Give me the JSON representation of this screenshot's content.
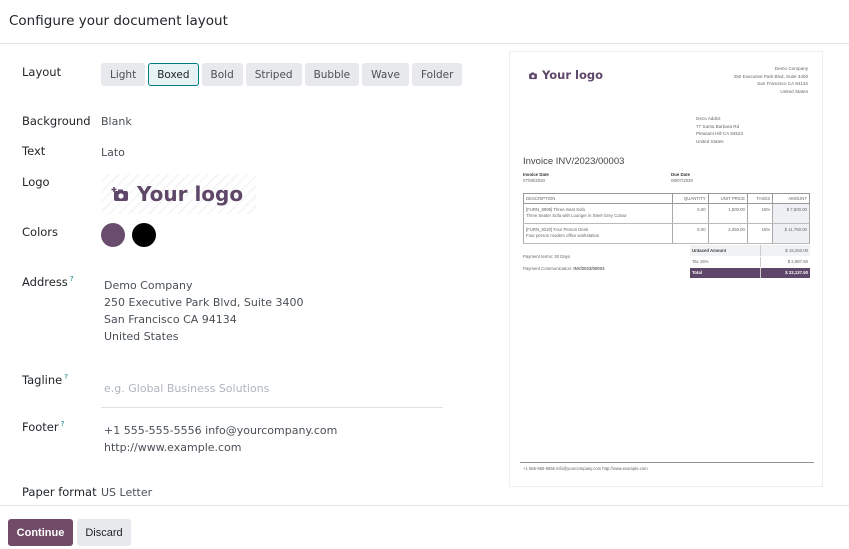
{
  "header": {
    "title": "Configure your document layout"
  },
  "form": {
    "layout": {
      "label": "Layout",
      "options": [
        "Light",
        "Boxed",
        "Bold",
        "Striped",
        "Bubble",
        "Wave",
        "Folder"
      ],
      "selected": "Boxed"
    },
    "background": {
      "label": "Background",
      "value": "Blank"
    },
    "text": {
      "label": "Text",
      "value": "Lato"
    },
    "logo": {
      "label": "Logo",
      "text": "Your logo"
    },
    "colors": {
      "label": "Colors",
      "primary": "#6a4c6e",
      "secondary": "#000000"
    },
    "address": {
      "label": "Address",
      "help": "?",
      "lines": [
        "Demo Company",
        "250 Executive Park Blvd, Suite 3400",
        "San Francisco CA 94134",
        "United States"
      ]
    },
    "tagline": {
      "label": "Tagline",
      "help": "?",
      "value": "",
      "placeholder": "e.g. Global Business Solutions"
    },
    "footer": {
      "label": "Footer",
      "help": "?",
      "lines": [
        "+1 555-555-5556 info@yourcompany.com",
        "http://www.example.com"
      ]
    },
    "paper_format": {
      "label": "Paper format",
      "value": "US Letter"
    }
  },
  "buttons": {
    "continue": "Continue",
    "discard": "Discard"
  },
  "preview": {
    "logo_text": "Your logo",
    "company_lines": [
      "Demo Company",
      "250 Executive Park Blvd, Suite 3400",
      "San Francisco CA 94134",
      "United States"
    ],
    "customer_lines": [
      "Deco Addict",
      "77 Santa Barbara Rd",
      "Pleasant Hill CA 94523",
      "United States"
    ],
    "title": "Invoice INV/2023/00003",
    "invoice_date_label": "Invoice Date",
    "invoice_date": "07/08/2020",
    "due_date_label": "Due Date",
    "due_date": "08/07/2020",
    "columns": [
      "DESCRIPTION",
      "QUANTITY",
      "UNIT PRICE",
      "TAXES",
      "AMOUNT"
    ],
    "rows": [
      {
        "desc1": "[FURN_8999] Three-Seat Sofa",
        "desc2": "Three Seater Sofa with Lounger in Steel Grey Colour",
        "qty": "5.00",
        "price": "1,500.00",
        "tax": "15%",
        "amount": "$ 7,500.00"
      },
      {
        "desc1": "[FURN_8220] Four Person Desk",
        "desc2": "Four person modern office workstation",
        "qty": "5.00",
        "price": "2,350.00",
        "tax": "15%",
        "amount": "$ 11,750.00"
      }
    ],
    "payment_terms": "Payment terms: 30 Days",
    "payment_comm_label": "Payment Communication:",
    "payment_comm": "INV/2023/00003",
    "totals": [
      {
        "label": "Untaxed Amount",
        "value": "$ 19,250.00"
      },
      {
        "label": "Tax 15%",
        "value": "$ 2,887.50"
      },
      {
        "label": "Total",
        "value": "$ 22,137.50"
      }
    ],
    "footer": "+1 555-555-5556 info@yourcompany.com http://www.example.com"
  }
}
